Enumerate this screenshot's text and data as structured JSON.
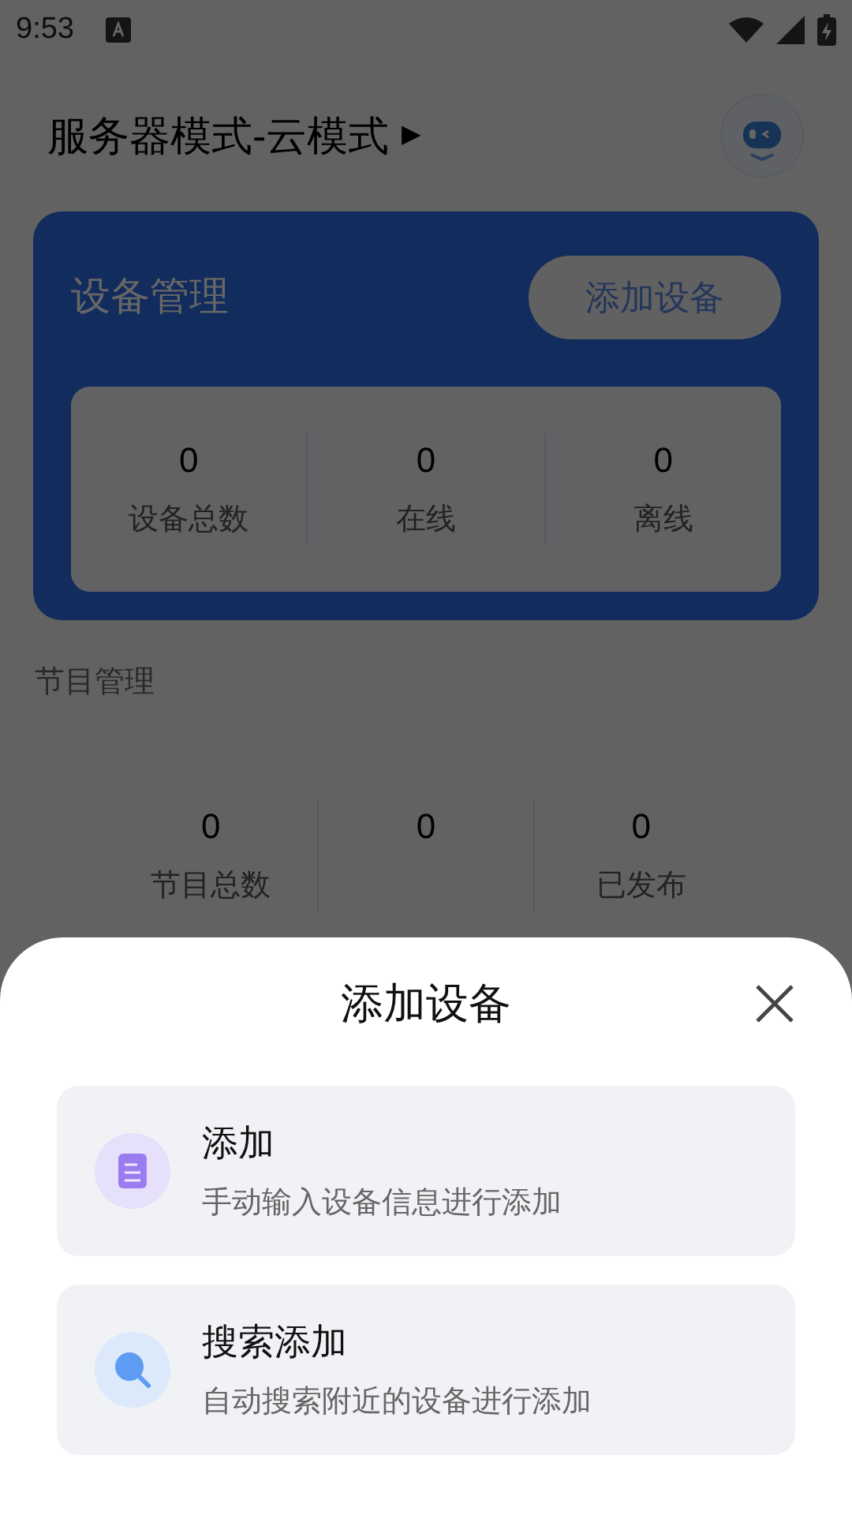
{
  "status_bar": {
    "time": "9:53"
  },
  "header": {
    "title": "服务器模式-云模式",
    "caret": "▶"
  },
  "device_card": {
    "title": "设备管理",
    "button": "添加设备",
    "stats": [
      {
        "value": "0",
        "label": "设备总数"
      },
      {
        "value": "0",
        "label": "在线"
      },
      {
        "value": "0",
        "label": "离线"
      }
    ]
  },
  "program_section": {
    "title": "节目管理",
    "stats": [
      {
        "value": "0",
        "label": "节目总数"
      },
      {
        "value": "0"
      },
      {
        "value": "0",
        "label": "已发布"
      }
    ]
  },
  "sheet": {
    "title": "添加设备",
    "options": [
      {
        "kind": "manual",
        "title": "添加",
        "description": "手动输入设备信息进行添加"
      },
      {
        "kind": "search",
        "title": "搜索添加",
        "description": "自动搜索附近的设备进行添加"
      }
    ]
  }
}
